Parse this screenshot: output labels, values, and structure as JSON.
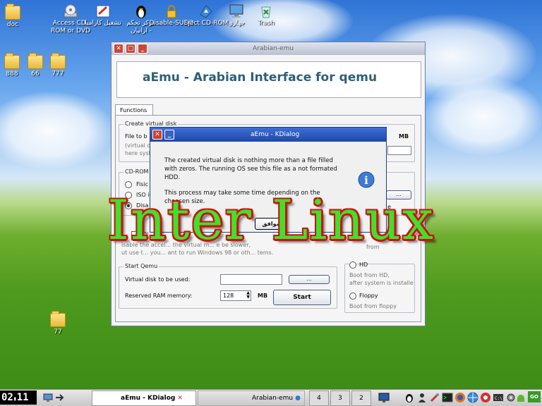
{
  "desktop_icons": [
    {
      "label": "doc",
      "icon": "folder-icon"
    },
    {
      "label": "Access CD-ROM or DVD",
      "icon": "cdrom-icon"
    },
    {
      "label": "تشغيل كارامبا",
      "icon": "karamba-icon"
    },
    {
      "label": "مركز تحكم ارابيان -",
      "icon": "tux-icon"
    },
    {
      "label": "Disable-SUDO",
      "icon": "lock-icon"
    },
    {
      "label": "Eject CD-ROM",
      "icon": "eject-cd-icon"
    },
    {
      "label": "جهازي",
      "icon": "computer-icon"
    },
    {
      "label": "Trash",
      "icon": "trash-icon"
    },
    {
      "label": "888",
      "icon": "folder-icon"
    },
    {
      "label": "66",
      "icon": "folder-icon"
    },
    {
      "label": "777",
      "icon": "folder-icon"
    },
    {
      "label": "77",
      "icon": "folder-icon"
    }
  ],
  "main_window": {
    "title": "Arabian-emu",
    "header": "aEmu - Arabian Interface for qemu",
    "tab": "Functions",
    "create_disk": {
      "legend": "Create virtual disk",
      "label": "File to b",
      "hint1": "(virtual d",
      "hint2": "here syst",
      "unit": "MB"
    },
    "cdrom": {
      "legend": "CD-ROM",
      "opt1": "Fisic",
      "opt2": "ISO i",
      "opt3": "Disa",
      "browse": "...",
      "right_partial": "e"
    },
    "disable": {
      "label": "Di",
      "text": "isable the accel... the virtual m... e be slower,",
      "text2": "ut use t... you... ant to run Windows 98 or oth... tems.",
      "right_partial": "from"
    },
    "start_qemu": {
      "legend": "Start Qemu",
      "vdisk_label": "Virtual disk to be used:",
      "vdisk_value": "",
      "browse": "...",
      "ram_label": "Reserved RAM memory:",
      "ram_value": "128",
      "ram_unit": "MB",
      "start": "Start"
    },
    "boot": {
      "hd_label": "Boot from HD,",
      "hd_label2": "after system is installe",
      "floppy": "Floppy",
      "floppy_hint": "Boot from floppy",
      "cut_label": "HD"
    }
  },
  "dialog": {
    "title": "aEmu - KDialog",
    "line1": "The created virtual disk is nothing more than a file filled",
    "line2": "with zeros. The running OS see this file as a not formated",
    "line3": "HDD.",
    "line4": "This process may take some time depending on the",
    "line5": "choosen size.",
    "ok": "موافق"
  },
  "overlay_text": "Inter Linux",
  "taskbar": {
    "clock_h": "02",
    "clock_m": "11",
    "task1": "aEmu - KDialog",
    "task2": "Arabian-emu",
    "desktops": [
      "4",
      "3",
      "2"
    ],
    "go": "GO"
  }
}
